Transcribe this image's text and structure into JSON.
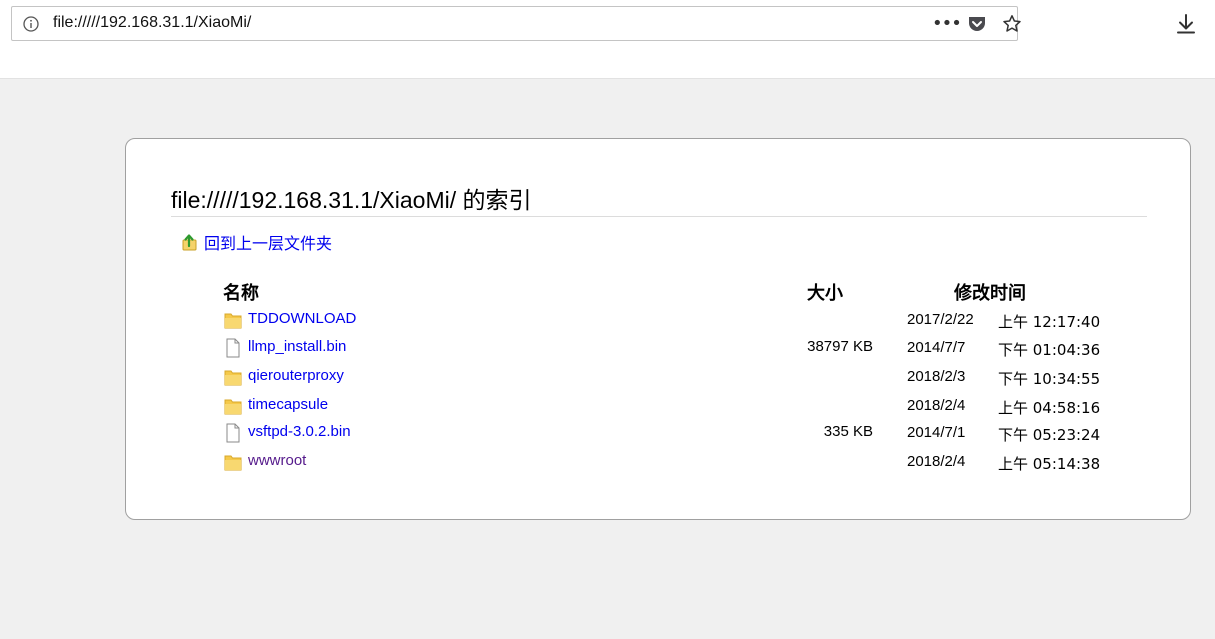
{
  "browser": {
    "url": "file://///192.168.31.1/XiaoMi/",
    "page_actions_label": "•••",
    "icons": [
      "info-icon",
      "page-actions-icon",
      "pocket-icon",
      "bookmark-star-icon",
      "download-icon"
    ]
  },
  "listing": {
    "title": "file://///192.168.31.1/XiaoMi/ 的索引",
    "up_link_label": "回到上一层文件夹",
    "headers": {
      "name": "名称",
      "size": "大小",
      "modified": "修改时间"
    },
    "rows": [
      {
        "name": "TDDOWNLOAD",
        "type": "folder",
        "size": "",
        "date": "2017/2/22",
        "time": "上午 12:17:40",
        "visited": false
      },
      {
        "name": "llmp_install.bin",
        "type": "file",
        "size": "38797 KB",
        "date": "2014/7/7",
        "time": "下午 01:04:36",
        "visited": false
      },
      {
        "name": "qierouterproxy",
        "type": "folder",
        "size": "",
        "date": "2018/2/3",
        "time": "下午 10:34:55",
        "visited": false
      },
      {
        "name": "timecapsule",
        "type": "folder",
        "size": "",
        "date": "2018/2/4",
        "time": "上午 04:58:16",
        "visited": false
      },
      {
        "name": "vsftpd-3.0.2.bin",
        "type": "file",
        "size": "335 KB",
        "date": "2014/7/1",
        "time": "下午 05:23:24",
        "visited": false
      },
      {
        "name": "wwwroot",
        "type": "folder",
        "size": "",
        "date": "2018/2/4",
        "time": "上午 05:14:38",
        "visited": true
      }
    ]
  },
  "colors": {
    "link": "#0000ee",
    "visited_link": "#551a8b",
    "page_bg": "#f0f0f0",
    "folder": "#f5c94a"
  }
}
